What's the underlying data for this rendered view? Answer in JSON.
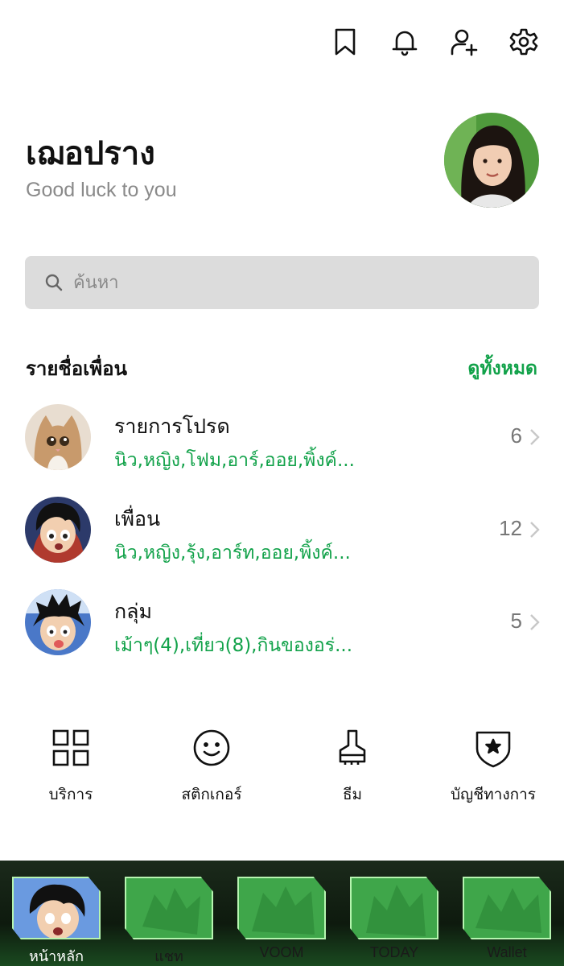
{
  "topbar": {
    "icons": [
      "bookmark-icon",
      "bell-icon",
      "add-friend-icon",
      "gear-icon"
    ]
  },
  "profile": {
    "name": "เฌอปราง",
    "status": "Good luck to you"
  },
  "search": {
    "placeholder": "ค้นหา"
  },
  "friends": {
    "title": "รายชื่อเพื่อน",
    "see_all": "ดูทั้งหมด",
    "rows": [
      {
        "title": "รายการโปรด",
        "subtitle": "นิว,หญิง,โฟม,อาร์,ออย,พิ้งค์...",
        "count": "6"
      },
      {
        "title": "เพื่อน",
        "subtitle": "นิว,หญิง,รุ้ง,อาร์ท,ออย,พิ้งค์...",
        "count": "12"
      },
      {
        "title": "กลุ่ม",
        "subtitle": "เม้าๆ(4),เที่ยว(8),กินของอร่...",
        "count": "5"
      }
    ]
  },
  "shortcuts": [
    {
      "label": "บริการ",
      "icon": "grid-icon"
    },
    {
      "label": "สติกเกอร์",
      "icon": "smiley-icon"
    },
    {
      "label": "ธีม",
      "icon": "brush-icon"
    },
    {
      "label": "บัญชีทางการ",
      "icon": "shield-star-icon"
    }
  ],
  "tabs": [
    {
      "label": "หน้าหลัก",
      "active": true
    },
    {
      "label": "แชท",
      "active": false
    },
    {
      "label": "VOOM",
      "active": false
    },
    {
      "label": "TODAY",
      "active": false
    },
    {
      "label": "Wallet",
      "active": false
    }
  ],
  "colors": {
    "accent_green": "#12a24a",
    "search_bg": "#dcdcdc",
    "tab_green": "#3fa64a"
  }
}
